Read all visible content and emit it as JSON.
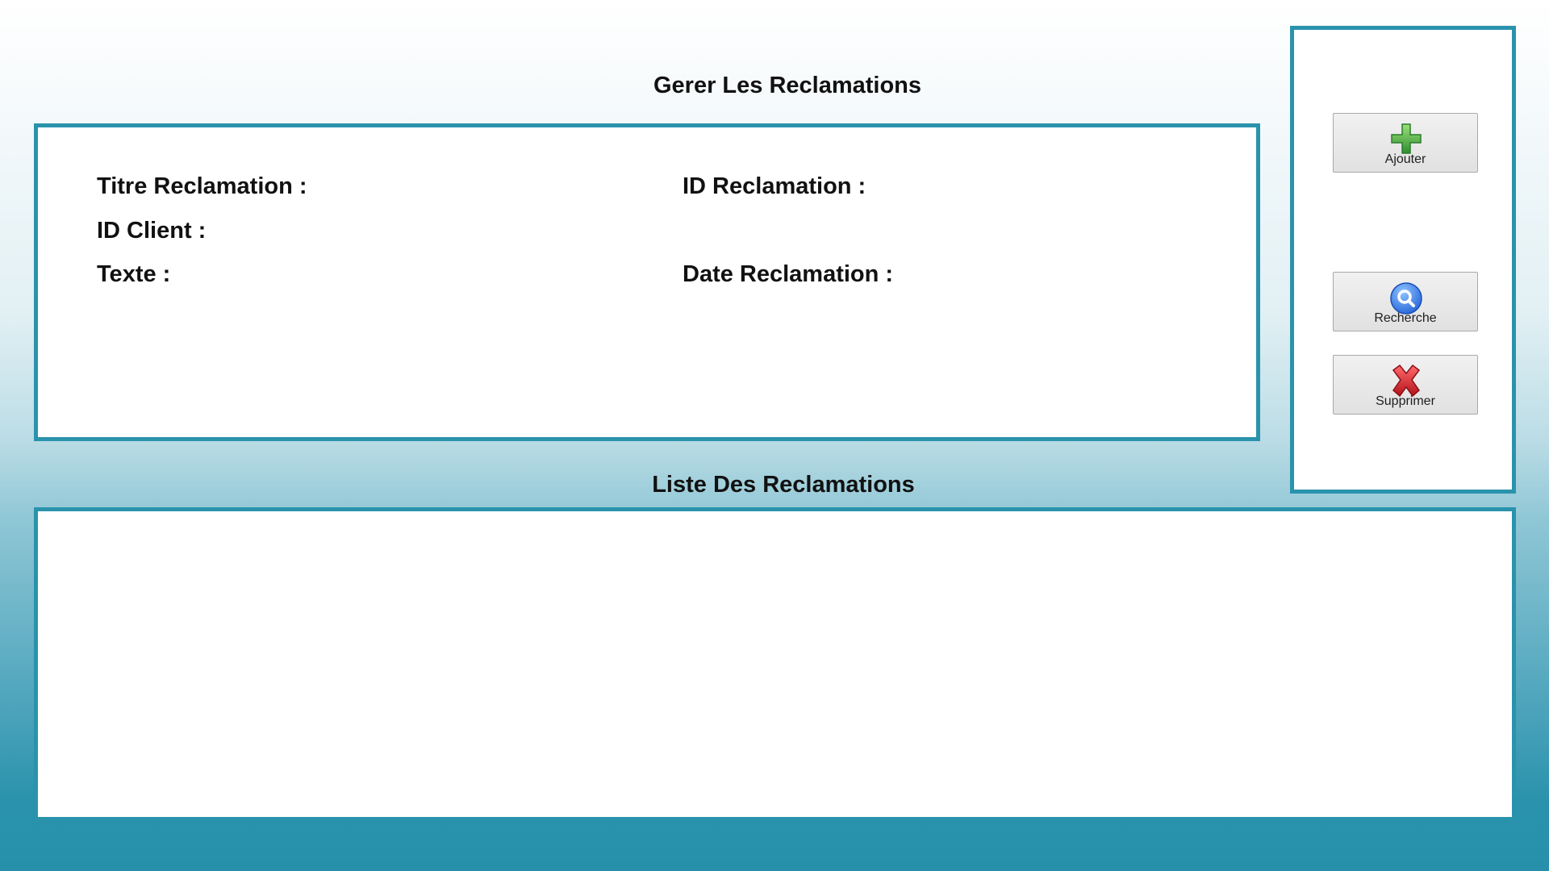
{
  "headings": {
    "manage": "Gerer Les Reclamations",
    "list": "Liste Des Reclamations"
  },
  "form": {
    "titre_label": "Titre Reclamation :",
    "id_reclamation_label": "ID Reclamation :",
    "id_client_label": "ID Client :",
    "texte_label": "Texte :",
    "date_label": "Date Reclamation :"
  },
  "actions": {
    "ajouter": {
      "label": "Ajouter",
      "icon": "plus-icon"
    },
    "recherche": {
      "label": "Recherche",
      "icon": "search-icon"
    },
    "supprimer": {
      "label": "Supprimer",
      "icon": "delete-x-icon"
    }
  },
  "colors": {
    "panel_border": "#2a93ac",
    "add_icon": "#3fa93f",
    "search_icon": "#2f6fe0",
    "delete_icon": "#d8212a"
  }
}
